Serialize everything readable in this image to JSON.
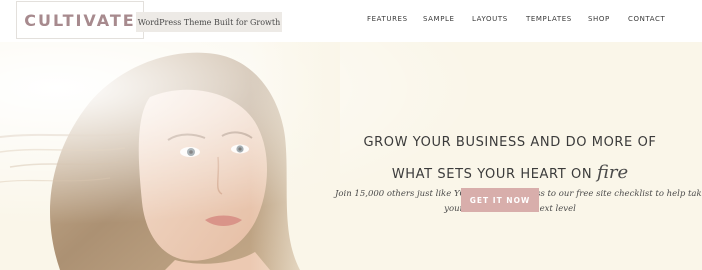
{
  "header": {
    "logo": "CULTIVATE",
    "tagline": "WordPress Theme Built for Growth",
    "nav": [
      {
        "label": "FEATURES"
      },
      {
        "label": "SAMPLE"
      },
      {
        "label": "LAYOUTS"
      },
      {
        "label": "TEMPLATES"
      },
      {
        "label": "SHOP"
      },
      {
        "label": "CONTACT"
      }
    ]
  },
  "hero": {
    "headline_line1": "GROW YOUR BUSINESS AND DO MORE OF",
    "headline_line2_prefix": "WHAT SETS YOUR HEART ON",
    "headline_script_word": "fire",
    "subtext_line1": "Join 15,000 others just like YOU and gain access to our free site checklist to help take",
    "subtext_line2": "your business to the next level",
    "cta_label": "GET IT NOW"
  },
  "colors": {
    "background": "#faf6e9",
    "logo": "#a78a8e",
    "button": "#d8aeab",
    "text": "#3b3b3b"
  }
}
